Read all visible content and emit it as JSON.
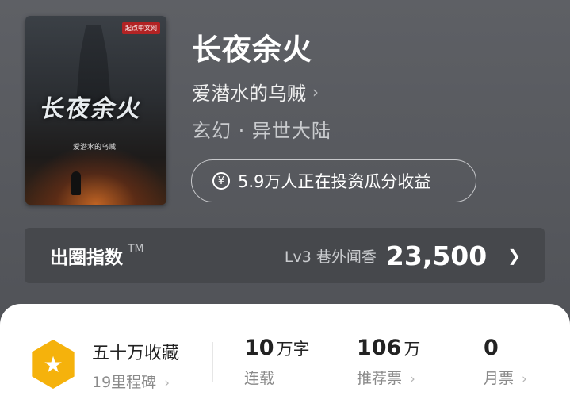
{
  "book": {
    "cover_title": "长夜余火",
    "cover_author": "爱潜水的乌贼",
    "cover_publisher": "起点中文网",
    "title": "长夜余火",
    "author": "爱潜水的乌贼",
    "genre": "玄幻 · 异世大陆",
    "invest_text": "5.9万人正在投资瓜分收益"
  },
  "index_bar": {
    "title": "出圈指数",
    "trademark": "TM",
    "level": "Lv3 巷外闻香",
    "score": "23,500"
  },
  "stats": {
    "badge": {
      "title": "五十万收藏",
      "subtitle": "19里程碑"
    },
    "items": [
      {
        "value": "10",
        "unit": "万字",
        "label": "连载"
      },
      {
        "value": "106",
        "unit": "万",
        "label": "推荐票"
      },
      {
        "value": "0",
        "unit": "",
        "label": "月票"
      }
    ]
  },
  "colors": {
    "badge_yellow": "#f5b20c",
    "background": "#5a5c61",
    "panel": "#ffffff"
  },
  "icons": [
    "yen-icon",
    "chevron-right-icon",
    "star-icon"
  ]
}
